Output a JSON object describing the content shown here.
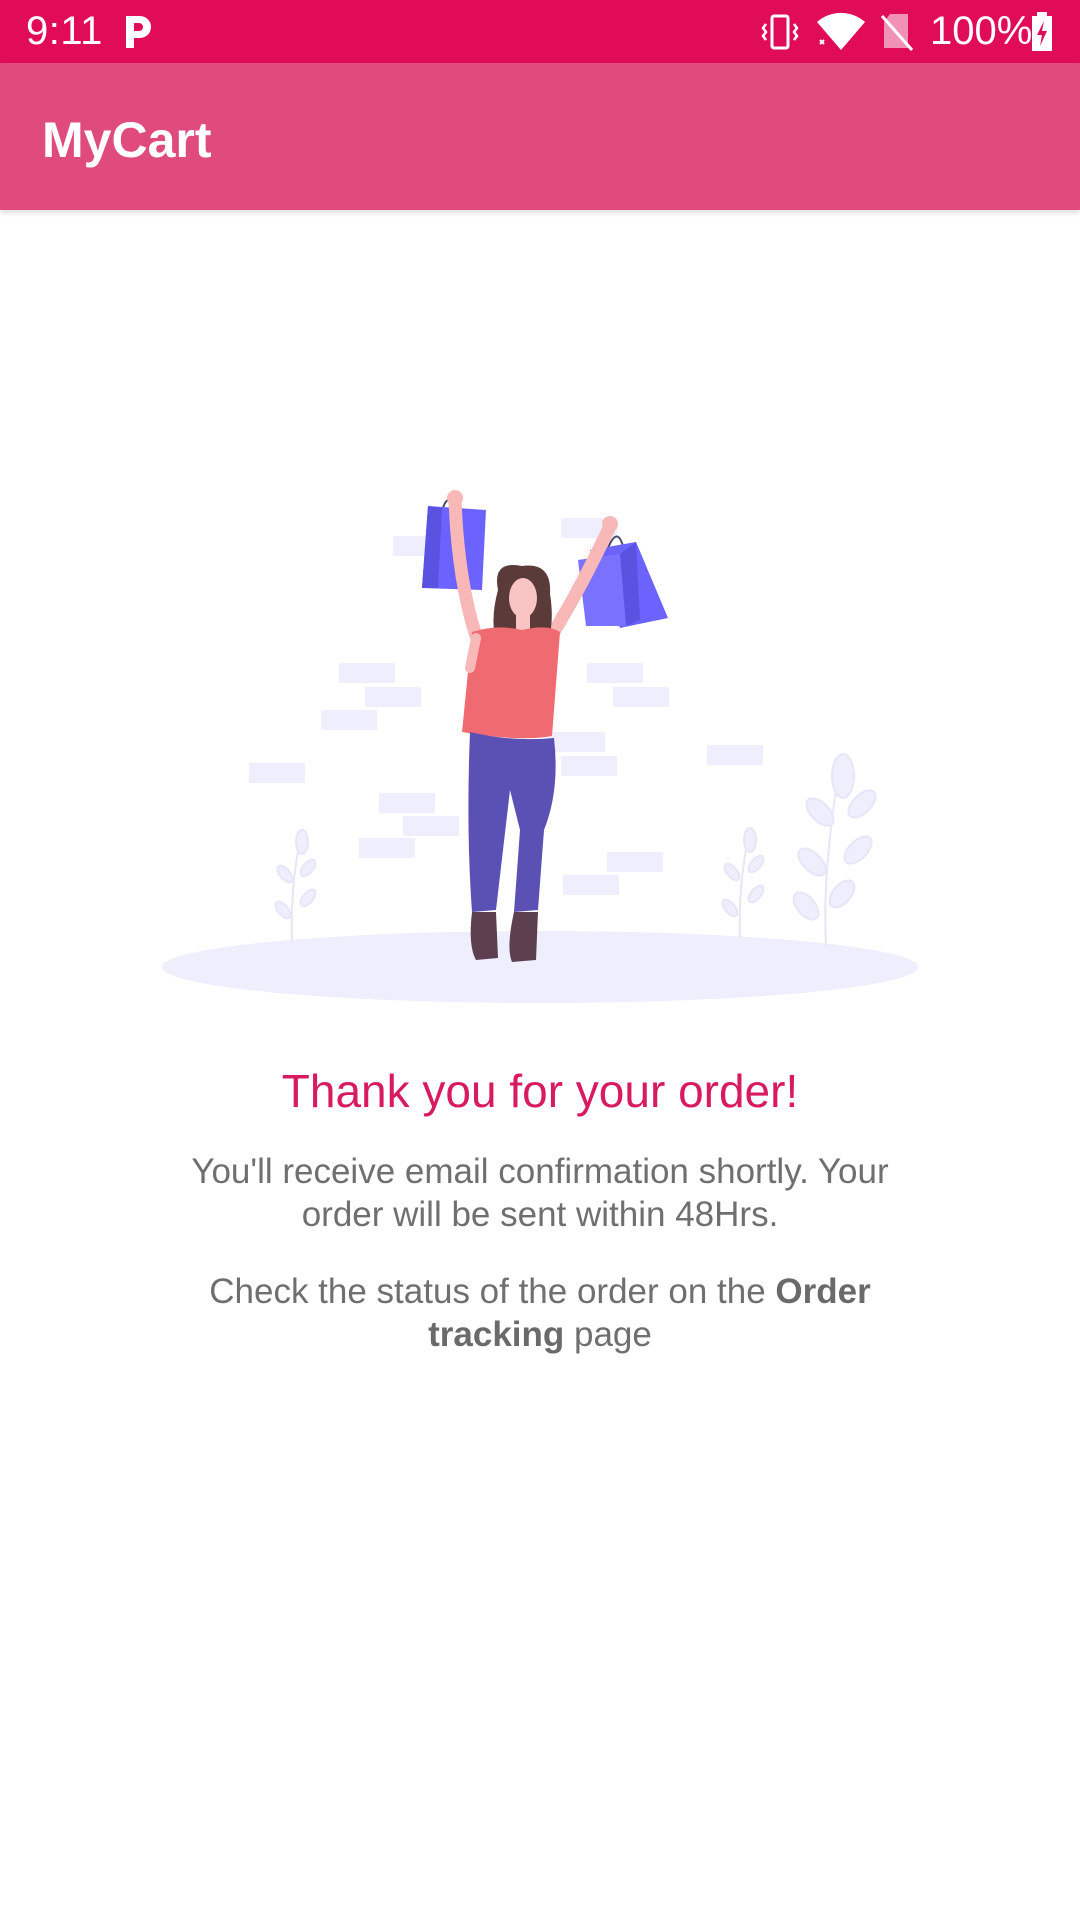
{
  "status_bar": {
    "time": "9:11",
    "battery": "100%",
    "background_color": "#e00c58",
    "icons": [
      "p-icon",
      "vibrate-icon",
      "wifi-icon",
      "no-sim-icon",
      "battery-charging-icon"
    ]
  },
  "app_bar": {
    "title": "MyCart",
    "background_color": "#e04b7d"
  },
  "illustration": {
    "subject": "woman-holding-shopping-bags"
  },
  "confirmation": {
    "title": "Thank you for your order!",
    "title_color": "#d81b60",
    "message": "You'll receive email confirmation shortly. Your order will be sent within 48Hrs.",
    "status_prefix": "Check the status of the order on the ",
    "status_link": "Order tracking",
    "status_suffix": " page"
  }
}
